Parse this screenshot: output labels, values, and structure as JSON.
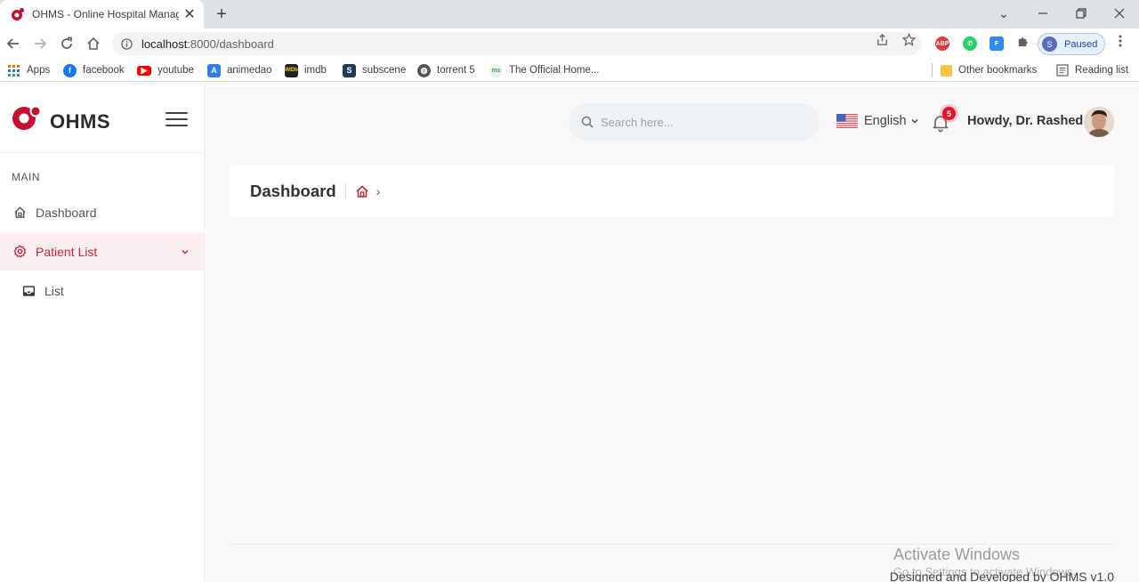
{
  "browser": {
    "tab_title": "OHMS - Online Hospital Management",
    "url_host": "localhost",
    "url_rest": ":8000/dashboard",
    "profile_initial": "S",
    "profile_status": "Paused",
    "bookmarks": [
      {
        "label": "Apps",
        "icon": "apps-grid-icon",
        "color": "#e8710a"
      },
      {
        "label": "facebook",
        "icon": "facebook-icon",
        "color": "#1877f2"
      },
      {
        "label": "youtube",
        "icon": "youtube-icon",
        "color": "#ff0000"
      },
      {
        "label": "animedao",
        "icon": "animedao-icon",
        "color": "#2f80ed"
      },
      {
        "label": "imdb",
        "icon": "imdb-icon",
        "color": "#222222"
      },
      {
        "label": "subscene",
        "icon": "subscene-icon",
        "color": "#1f3b57"
      },
      {
        "label": "torrent 5",
        "icon": "torrent-icon",
        "color": "#555555"
      },
      {
        "label": "The Official Home...",
        "icon": "official-home-icon",
        "color": "#3aa757"
      }
    ],
    "other_bookmarks": "Other bookmarks",
    "reading_list": "Reading list"
  },
  "sidebar": {
    "brand": "OHMS",
    "section_label": "MAIN",
    "items": [
      {
        "label": "Dashboard",
        "icon": "home-icon"
      },
      {
        "label": "Patient List",
        "icon": "gear-icon",
        "active": true
      },
      {
        "label": "List",
        "icon": "inbox-icon"
      }
    ]
  },
  "topbar": {
    "search_placeholder": "Search here...",
    "language": "English",
    "notification_count": "5",
    "greeting": "Howdy, Dr. Rashed"
  },
  "page": {
    "title": "Dashboard"
  },
  "footer": {
    "text": "Designed and Developed by OHMS v1.0"
  },
  "overlay": {
    "activate_title": "Activate Windows",
    "activate_sub": "Go to Settings to activate Windows."
  },
  "colors": {
    "accent": "#c6283b",
    "active_bg": "#fbeef0",
    "badge": "#e3132a"
  }
}
